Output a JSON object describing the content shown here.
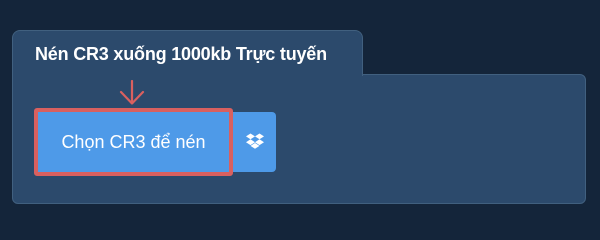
{
  "tool": {
    "title": "Nén CR3 xuống 1000kb Trực tuyến",
    "choose_button_label": "Chọn CR3 để nén"
  },
  "icons": {
    "dropbox": "dropbox-icon",
    "arrow": "arrow-down-icon"
  },
  "colors": {
    "background": "#14253a",
    "panel": "#2c4a6c",
    "button": "#4e9ae8",
    "highlight": "#d9605f"
  }
}
